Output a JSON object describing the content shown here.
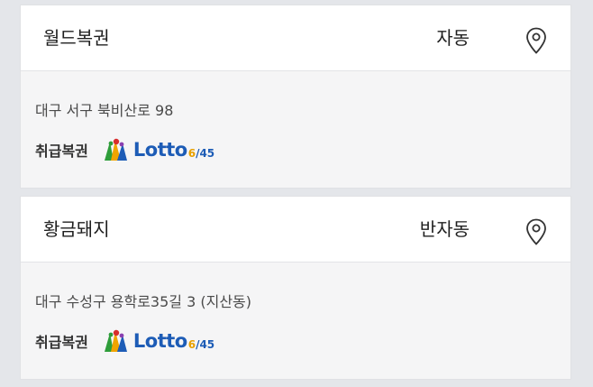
{
  "stores": [
    {
      "name": "월드복권",
      "type": "자동",
      "address": "대구 서구 북비산로 98",
      "sells_label": "취급복권",
      "lotto_word": "Lotto",
      "lotto_six": "6",
      "lotto_rest": "/45",
      "pin_icon": "location-pin-icon"
    },
    {
      "name": "황금돼지",
      "type": "반자동",
      "address": "대구 수성구 용학로35길 3 (지산동)",
      "sells_label": "취급복권",
      "lotto_word": "Lotto",
      "lotto_six": "6",
      "lotto_rest": "/45",
      "pin_icon": "location-pin-icon"
    }
  ],
  "colors": {
    "background": "#e4e6ea",
    "card_header": "#ffffff",
    "card_body": "#f5f5f6",
    "lotto_blue": "#1d5cb6"
  }
}
